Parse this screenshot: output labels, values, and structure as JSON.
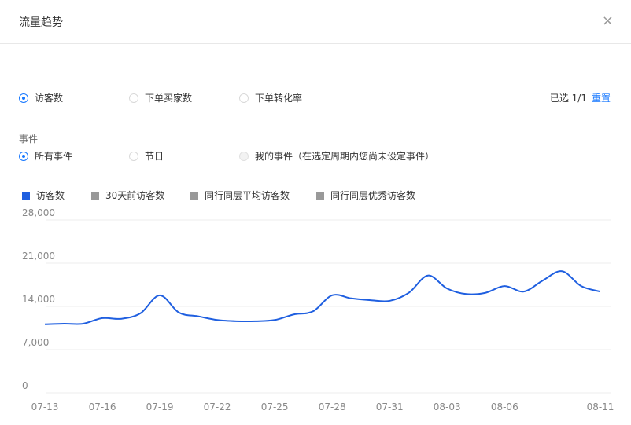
{
  "header": {
    "title": "流量趋势",
    "close_glyph": "×"
  },
  "metrics": {
    "options": [
      {
        "label": "访客数",
        "checked": true
      },
      {
        "label": "下单买家数",
        "checked": false
      },
      {
        "label": "下单转化率",
        "checked": false
      }
    ],
    "selected_label": "已选 1/1",
    "reset_label": "重置"
  },
  "events": {
    "label": "事件",
    "options": [
      {
        "label": "所有事件",
        "checked": true
      },
      {
        "label": "节日",
        "checked": false
      },
      {
        "label": "我的事件（在选定周期内您尚未设定事件）",
        "checked": false,
        "disabled": true
      }
    ]
  },
  "legend": [
    {
      "label": "访客数",
      "color": "#1f5fe0"
    },
    {
      "label": "30天前访客数",
      "color": "#999999"
    },
    {
      "label": "同行同层平均访客数",
      "color": "#999999"
    },
    {
      "label": "同行同层优秀访客数",
      "color": "#999999"
    }
  ],
  "colors": {
    "accent": "#1677ff",
    "line": "#1f5fe0",
    "grid": "#eeeeee"
  },
  "chart_data": {
    "type": "line",
    "ylim": [
      0,
      28000
    ],
    "y_ticks": [
      "28,000",
      "21,000",
      "14,000",
      "7,000",
      "0"
    ],
    "y_tick_values": [
      28000,
      21000,
      14000,
      7000,
      0
    ],
    "x_tick_labels": [
      "07-13",
      "07-16",
      "07-19",
      "07-22",
      "07-25",
      "07-28",
      "07-31",
      "08-03",
      "08-06",
      "08-11"
    ],
    "x_tick_dates": [
      "07-13",
      "07-16",
      "07-19",
      "07-22",
      "07-25",
      "07-28",
      "07-31",
      "08-03",
      "08-06",
      "08-11"
    ],
    "x": [
      "07-13",
      "07-14",
      "07-15",
      "07-16",
      "07-17",
      "07-18",
      "07-19",
      "07-20",
      "07-21",
      "07-22",
      "07-23",
      "07-24",
      "07-25",
      "07-26",
      "07-27",
      "07-28",
      "07-29",
      "07-30",
      "07-31",
      "08-01",
      "08-02",
      "08-03",
      "08-04",
      "08-05",
      "08-06",
      "08-07",
      "08-08",
      "08-09",
      "08-10",
      "08-11"
    ],
    "series": [
      {
        "name": "访客数",
        "values": [
          11100,
          11200,
          11200,
          12100,
          12000,
          12900,
          15800,
          13000,
          12400,
          11800,
          11600,
          11600,
          11800,
          12700,
          13200,
          15800,
          15300,
          15000,
          14900,
          16200,
          19000,
          16900,
          16000,
          16200,
          17300,
          16400,
          18200,
          19700,
          17300,
          16400
        ]
      }
    ]
  }
}
